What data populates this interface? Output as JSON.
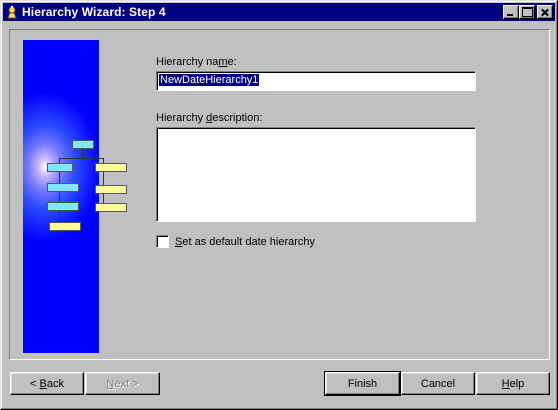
{
  "window": {
    "title": "Hierarchy Wizard: Step 4",
    "icon": "wizard-icon",
    "controls": [
      "minimize-icon",
      "maximize-icon",
      "close-icon"
    ]
  },
  "form": {
    "name_label_pre": "Hierarchy na",
    "name_label_u": "m",
    "name_label_post": "e:",
    "name_value": "NewDateHierarchy1",
    "description_label_pre": "Hierarchy ",
    "description_label_u": "d",
    "description_label_post": "escription:",
    "description_value": "",
    "default_checkbox_u": "S",
    "default_checkbox_post": "et as default date hierarchy",
    "default_checked": false
  },
  "buttons": {
    "back_arrow": "<",
    "back_u": "B",
    "back_post": "ack",
    "next_u": "N",
    "next_post": "ext",
    "next_arrow": ">",
    "finish": "Finish",
    "cancel": "Cancel",
    "help_u": "H",
    "help_post": "elp"
  },
  "colors": {
    "title_bar": "#000080",
    "side_panel": "#0000ff",
    "face": "#c0c0c0"
  }
}
